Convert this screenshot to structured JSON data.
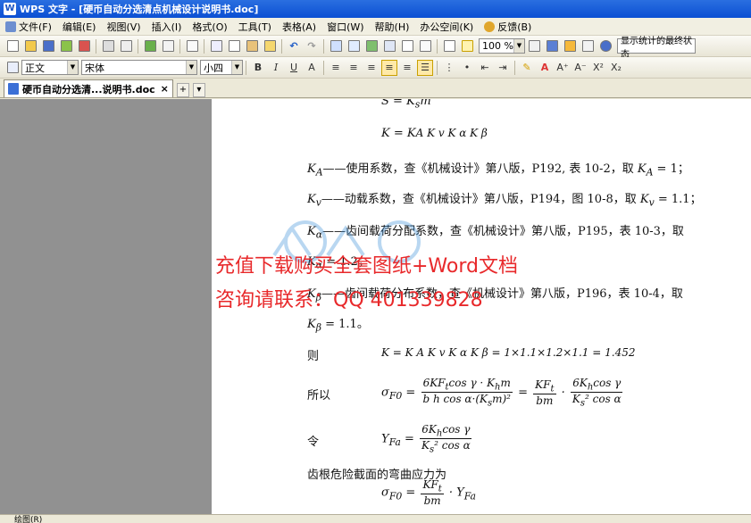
{
  "window": {
    "title": "WPS 文字 - [硬币自动分选清点机械设计说明书.doc]",
    "app_icon": "W"
  },
  "menu": [
    {
      "label": "文件(F)"
    },
    {
      "label": "编辑(E)"
    },
    {
      "label": "视图(V)"
    },
    {
      "label": "插入(I)"
    },
    {
      "label": "格式(O)"
    },
    {
      "label": "工具(T)"
    },
    {
      "label": "表格(A)"
    },
    {
      "label": "窗口(W)"
    },
    {
      "label": "帮助(H)"
    },
    {
      "label": "办公空间(K)"
    },
    {
      "label": "反馈(B)"
    }
  ],
  "toolbar": {
    "zoom": "100 %",
    "hint": "显示统计的最终状态"
  },
  "format_toolbar": {
    "style": "正文",
    "font": "宋体",
    "size": "小四"
  },
  "tab": {
    "label": "硬币自动分选清...说明书.doc",
    "close": "×",
    "add": "+"
  },
  "document": {
    "l1": "S = K",
    "l1_sub": "s",
    "l1_tail": "m",
    "l2": "K = K",
    "l2_rest": "A K v K α K β",
    "p_ka": "——使用系数，查《机械设计》第八版，P192, 表 10-2，取",
    "p_ka_val": "= 1；",
    "p_kv": "——动载系数，查《机械设计》第八版，P194，图 10-8，取",
    "p_kv_val": "= 1.1；",
    "p_kalpha": "——齿间载荷分配系数，查《机械设计》第八版，P195，表 10-3，取",
    "p_kalpha_val": "= 1.2；",
    "p_kbeta": "——齿间载荷分布系数，查《机械设计》第八版，P196，表 10-4，取",
    "p_kbeta_val": "= 1.1。",
    "ze": "则",
    "ze_formula": "K = K A K v K α K β = 1×1.1×1.2×1.1 = 1.452",
    "suoyi": "所以",
    "sigma_label": "σ",
    "sigma_sub": "F0",
    "ling": "令",
    "yfa_label": "Y",
    "yfa_sub": "Fa",
    "chigen": "齿根危险截面的弯曲应力为"
  },
  "overlay": {
    "line1": "充值下载购买全套图纸+Word文档",
    "line2": "咨询请联系：QQ 401339828"
  },
  "status": {
    "page": "绘图(R)"
  },
  "colors": {
    "title_bar": "#0b4fd3",
    "overlay": "#e8292b",
    "gutter": "#919191"
  }
}
